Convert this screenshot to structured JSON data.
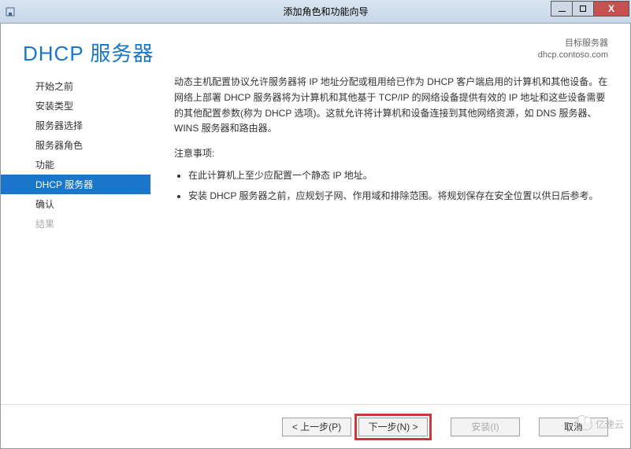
{
  "window": {
    "title": "添加角色和功能向导"
  },
  "header": {
    "title": "DHCP 服务器",
    "target_label": "目标服务器",
    "target_value": "dhcp.contoso.com"
  },
  "sidebar": {
    "items": [
      {
        "label": "开始之前",
        "selected": false,
        "dim": false
      },
      {
        "label": "安装类型",
        "selected": false,
        "dim": false
      },
      {
        "label": "服务器选择",
        "selected": false,
        "dim": false
      },
      {
        "label": "服务器角色",
        "selected": false,
        "dim": false
      },
      {
        "label": "功能",
        "selected": false,
        "dim": false
      },
      {
        "label": "DHCP 服务器",
        "selected": true,
        "dim": false
      },
      {
        "label": "确认",
        "selected": false,
        "dim": false
      },
      {
        "label": "结果",
        "selected": false,
        "dim": true
      }
    ]
  },
  "main": {
    "intro": "动态主机配置协议允许服务器将 IP 地址分配或租用给已作为 DHCP 客户端启用的计算机和其他设备。在网络上部署 DHCP 服务器将为计算机和其他基于 TCP/IP 的网络设备提供有效的 IP 地址和这些设备需要的其他配置参数(称为 DHCP 选项)。这就允许将计算机和设备连接到其他网络资源，如 DNS 服务器、WINS 服务器和路由器。",
    "note_title": "注意事项:",
    "notes": [
      "在此计算机上至少应配置一个静态 IP 地址。",
      "安装 DHCP 服务器之前，应规划子网、作用域和排除范围。将规划保存在安全位置以供日后参考。"
    ]
  },
  "footer": {
    "previous": "< 上一步(P)",
    "next": "下一步(N) >",
    "install": "安装(I)",
    "cancel": "取消"
  },
  "watermark": "亿速云"
}
